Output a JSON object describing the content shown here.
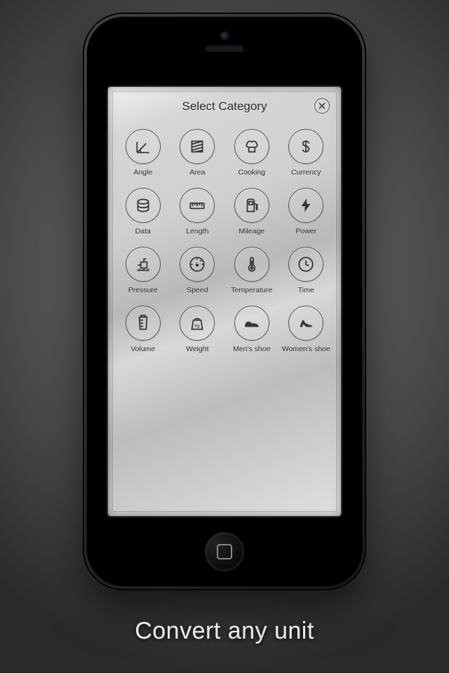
{
  "header": {
    "title": "Select Category"
  },
  "categories": [
    {
      "id": "angle",
      "label": "Angle",
      "icon": "angle-icon"
    },
    {
      "id": "area",
      "label": "Area",
      "icon": "area-icon"
    },
    {
      "id": "cooking",
      "label": "Cooking",
      "icon": "cooking-icon"
    },
    {
      "id": "currency",
      "label": "Currency",
      "icon": "currency-icon"
    },
    {
      "id": "data",
      "label": "Data",
      "icon": "data-icon"
    },
    {
      "id": "length",
      "label": "Length",
      "icon": "length-icon"
    },
    {
      "id": "mileage",
      "label": "Mileage",
      "icon": "mileage-icon"
    },
    {
      "id": "power",
      "label": "Power",
      "icon": "power-icon"
    },
    {
      "id": "pressure",
      "label": "Pressure",
      "icon": "pressure-icon"
    },
    {
      "id": "speed",
      "label": "Speed",
      "icon": "speed-icon"
    },
    {
      "id": "temperature",
      "label": "Temperature",
      "icon": "temperature-icon"
    },
    {
      "id": "time",
      "label": "Time",
      "icon": "time-icon"
    },
    {
      "id": "volume",
      "label": "Volume",
      "icon": "volume-icon"
    },
    {
      "id": "weight",
      "label": "Weight",
      "icon": "weight-icon"
    },
    {
      "id": "mens-shoe",
      "label": "Men's shoe",
      "icon": "mens-shoe-icon"
    },
    {
      "id": "womens-shoe",
      "label": "Women's shoe",
      "icon": "womens-shoe-icon"
    }
  ],
  "tagline": "Convert any unit"
}
